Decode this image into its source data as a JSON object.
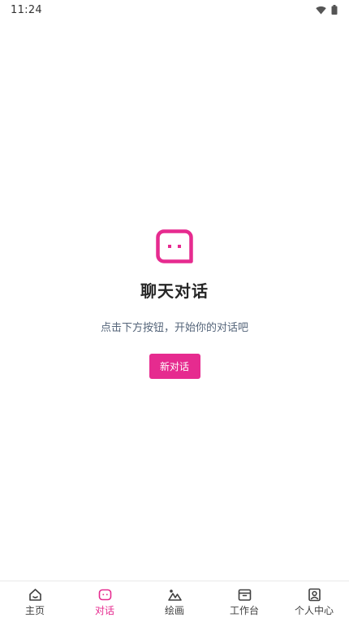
{
  "status_bar": {
    "time": "11:24"
  },
  "empty_state": {
    "title": "聊天对话",
    "description": "点击下方按钮，开始你的对话吧",
    "button_label": "新对话"
  },
  "tabs": [
    {
      "label": "主页",
      "icon": "home-icon",
      "active": false
    },
    {
      "label": "对话",
      "icon": "chat-icon",
      "active": true
    },
    {
      "label": "绘画",
      "icon": "mountain-icon",
      "active": false
    },
    {
      "label": "工作台",
      "icon": "archive-box-icon",
      "active": false
    },
    {
      "label": "个人中心",
      "icon": "profile-icon",
      "active": false
    }
  ],
  "colors": {
    "accent": "#e62b8f",
    "tab_inactive": "#3f3f3f",
    "description_text": "#55657a"
  }
}
